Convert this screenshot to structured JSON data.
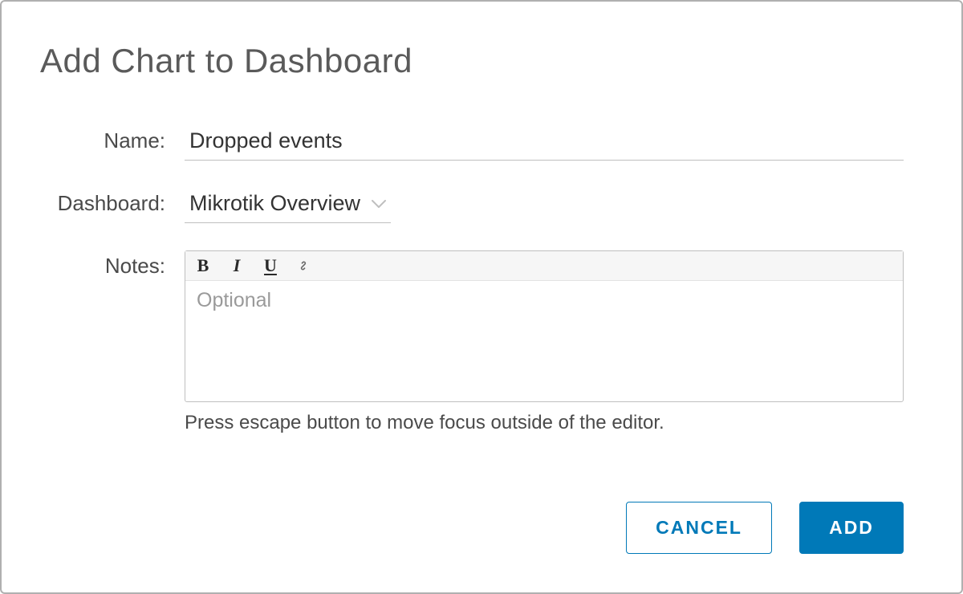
{
  "title": "Add Chart to Dashboard",
  "form": {
    "name": {
      "label": "Name:",
      "value": "Dropped events"
    },
    "dashboard": {
      "label": "Dashboard:",
      "value": "Mikrotik Overview"
    },
    "notes": {
      "label": "Notes:",
      "placeholder": "Optional",
      "hint": "Press escape button to move focus outside of the editor."
    }
  },
  "buttons": {
    "cancel": "CANCEL",
    "add": "ADD"
  }
}
